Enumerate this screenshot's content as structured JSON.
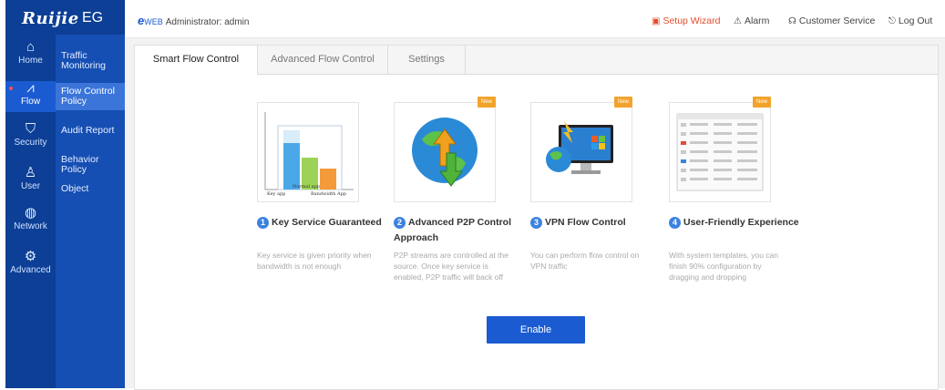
{
  "brand": {
    "name": "Ruijie",
    "product": "EG"
  },
  "topbar": {
    "eweb_e": "e",
    "eweb_web": "WEB",
    "admin_label": "Administrator: admin",
    "setup_wizard": "Setup Wizard",
    "alarm": "Alarm",
    "customer_service": "Customer Service",
    "logout": "Log Out"
  },
  "rail": [
    {
      "label": "Home",
      "icon": "home-icon"
    },
    {
      "label": "Flow",
      "icon": "flow-icon"
    },
    {
      "label": "Security",
      "icon": "shield-icon"
    },
    {
      "label": "User",
      "icon": "user-icon"
    },
    {
      "label": "Network",
      "icon": "globe-icon"
    },
    {
      "label": "Advanced",
      "icon": "gear-icon"
    }
  ],
  "submenu": [
    {
      "label": "Traffic Monitoring"
    },
    {
      "label": "Flow Control Policy"
    },
    {
      "label": "Audit Report"
    },
    {
      "label": "Behavior Policy"
    },
    {
      "label": "Object"
    }
  ],
  "tabs": [
    {
      "label": "Smart Flow Control"
    },
    {
      "label": "Advanced Flow Control"
    },
    {
      "label": "Settings"
    }
  ],
  "features": [
    {
      "num": "1",
      "title": "Key Service Guaranteed",
      "desc": "Key service is given priority when bandwidth is not enough",
      "badge": "",
      "chart_labels": [
        "Normal app",
        "Key app",
        "Bandwidth App"
      ]
    },
    {
      "num": "2",
      "title": "Advanced P2P Control Approach",
      "desc": "P2P streams are controlled at the source. Once key service is enabled, P2P traffic will back off",
      "badge": "New"
    },
    {
      "num": "3",
      "title": "VPN Flow Control",
      "desc": "You can perform flow control on VPN traffic",
      "badge": "New"
    },
    {
      "num": "4",
      "title": "User-Friendly Experience",
      "desc": "With system templates, you can finish 90% configuration by dragging and dropping",
      "badge": "New"
    }
  ],
  "enable_button": "Enable"
}
